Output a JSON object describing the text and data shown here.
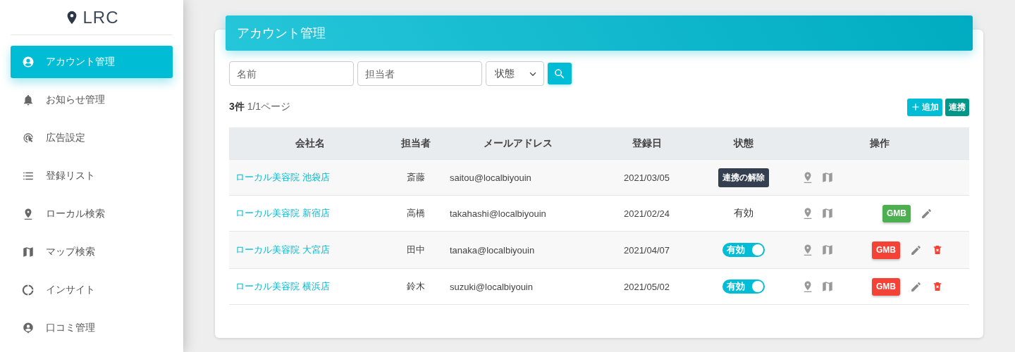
{
  "logo": {
    "text": "LRC"
  },
  "sidebar": {
    "items": [
      {
        "label": "アカウント管理",
        "kind": "account",
        "selected": true
      },
      {
        "label": "お知らせ管理",
        "kind": "bell",
        "selected": false
      },
      {
        "label": "広告設定",
        "kind": "click",
        "selected": false
      },
      {
        "label": "登録リスト",
        "kind": "list",
        "selected": false
      },
      {
        "label": "ローカル検索",
        "kind": "pin",
        "selected": false
      },
      {
        "label": "マップ検索",
        "kind": "map",
        "selected": false
      },
      {
        "label": "インサイト",
        "kind": "donut",
        "selected": false
      },
      {
        "label": "口コミ管理",
        "kind": "review",
        "selected": false
      }
    ]
  },
  "page": {
    "title": "アカウント管理"
  },
  "filters": {
    "name": {
      "placeholder": "名前"
    },
    "person": {
      "placeholder": "担当者"
    },
    "status": {
      "value": "状態"
    }
  },
  "summary": {
    "count": "3件",
    "pages": "1/1ページ"
  },
  "buttons": {
    "add": "追加",
    "link": "連携"
  },
  "table": {
    "columns": [
      "会社名",
      "担当者",
      "メールアドレス",
      "登録日",
      "状態",
      "操作"
    ],
    "rows": [
      {
        "company": "ローカル美容院 池袋店",
        "person": "斎藤",
        "email": "saitou@localbiyouin",
        "date": "2021/03/05",
        "status": {
          "kind": "button",
          "label": "連携の解除"
        },
        "actions": []
      },
      {
        "company": "ローカル美容院 新宿店",
        "person": "高橋",
        "email": "takahashi@localbiyouin",
        "date": "2021/02/24",
        "status": {
          "kind": "text",
          "label": "有効"
        },
        "actions": [
          {
            "kind": "gmb",
            "label": "GMB",
            "color": "#4caf50"
          },
          {
            "kind": "edit"
          }
        ]
      },
      {
        "company": "ローカル美容院 大宮店",
        "person": "田中",
        "email": "tanaka@localbiyouin",
        "date": "2021/04/07",
        "status": {
          "kind": "toggle",
          "label": "有効",
          "on": true
        },
        "actions": [
          {
            "kind": "gmb",
            "label": "GMB",
            "color": "#f44336"
          },
          {
            "kind": "edit"
          },
          {
            "kind": "delete"
          }
        ]
      },
      {
        "company": "ローカル美容院 横浜店",
        "person": "鈴木",
        "email": "suzuki@localbiyouin",
        "date": "2021/05/02",
        "status": {
          "kind": "toggle",
          "label": "有効",
          "on": true
        },
        "actions": [
          {
            "kind": "gmb",
            "label": "GMB",
            "color": "#f44336"
          },
          {
            "kind": "edit"
          },
          {
            "kind": "delete"
          }
        ]
      }
    ]
  }
}
